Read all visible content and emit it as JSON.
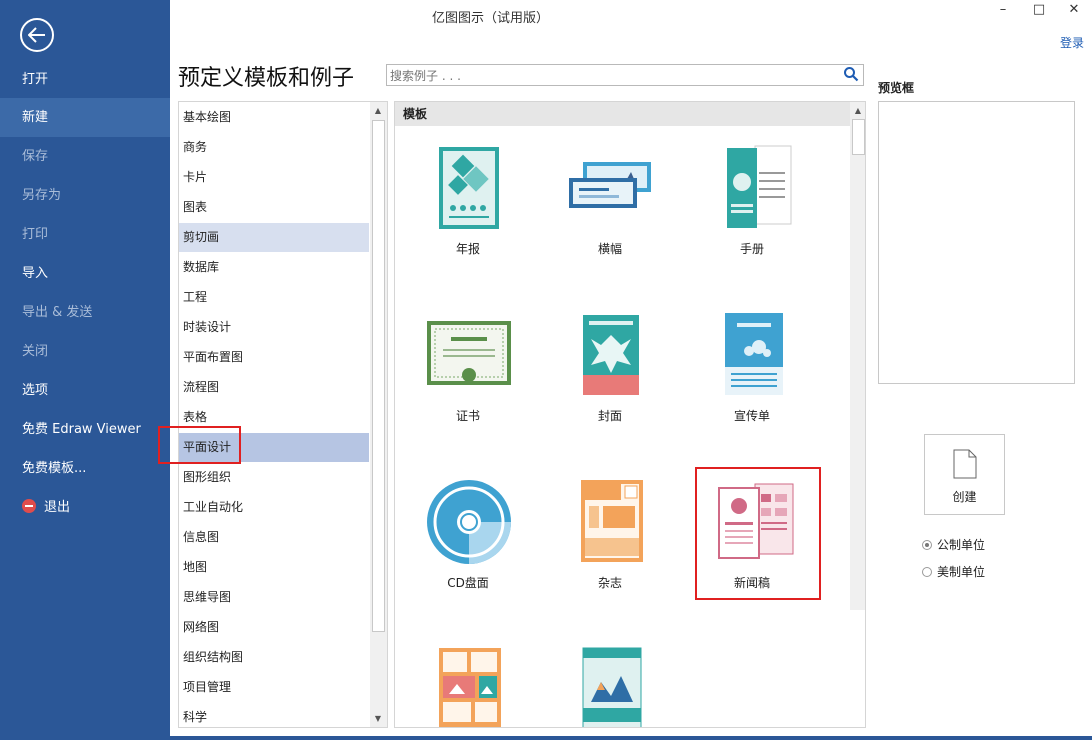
{
  "window": {
    "title": "亿图图示（试用版）",
    "login": "登录",
    "minimize": "–",
    "maximize": "□",
    "close": "✕"
  },
  "sidebar": {
    "items": [
      {
        "label": "打开"
      },
      {
        "label": "新建"
      },
      {
        "label": "保存"
      },
      {
        "label": "另存为"
      },
      {
        "label": "打印"
      },
      {
        "label": "导入"
      },
      {
        "label": "导出 & 发送"
      },
      {
        "label": "关闭"
      },
      {
        "label": "选项"
      },
      {
        "label": "免费 Edraw Viewer"
      },
      {
        "label": "免费模板..."
      },
      {
        "label": "退出"
      }
    ]
  },
  "main": {
    "heading": "预定义模板和例子",
    "search_placeholder": "搜索例子 . . ."
  },
  "categories": [
    "基本绘图",
    "商务",
    "卡片",
    "图表",
    "剪切画",
    "数据库",
    "工程",
    "时装设计",
    "平面布置图",
    "流程图",
    "表格",
    "平面设计",
    "图形组织",
    "工业自动化",
    "信息图",
    "地图",
    "思维导图",
    "网络图",
    "组织结构图",
    "项目管理",
    "科学"
  ],
  "templates": {
    "header": "模板",
    "items": [
      {
        "label": "年报",
        "icon": "annual-report-icon"
      },
      {
        "label": "横幅",
        "icon": "banner-icon"
      },
      {
        "label": "手册",
        "icon": "brochure-icon"
      },
      {
        "label": "证书",
        "icon": "certificate-icon"
      },
      {
        "label": "封面",
        "icon": "cover-icon"
      },
      {
        "label": "宣传单",
        "icon": "flyer-icon"
      },
      {
        "label": "CD盘面",
        "icon": "cd-icon"
      },
      {
        "label": "杂志",
        "icon": "magazine-icon"
      },
      {
        "label": "新闻稿",
        "icon": "newsletter-icon"
      },
      {
        "label": "",
        "icon": "photo-collage-icon"
      },
      {
        "label": "",
        "icon": "poster-icon"
      }
    ]
  },
  "preview": {
    "label": "预览框",
    "create": "创建"
  },
  "units": {
    "metric": "公制单位",
    "imperial": "美制单位",
    "selected": "metric"
  },
  "colors": {
    "sidebar": "#2b5797",
    "selection": "#b6c5e3",
    "highlight": "#e02020"
  }
}
